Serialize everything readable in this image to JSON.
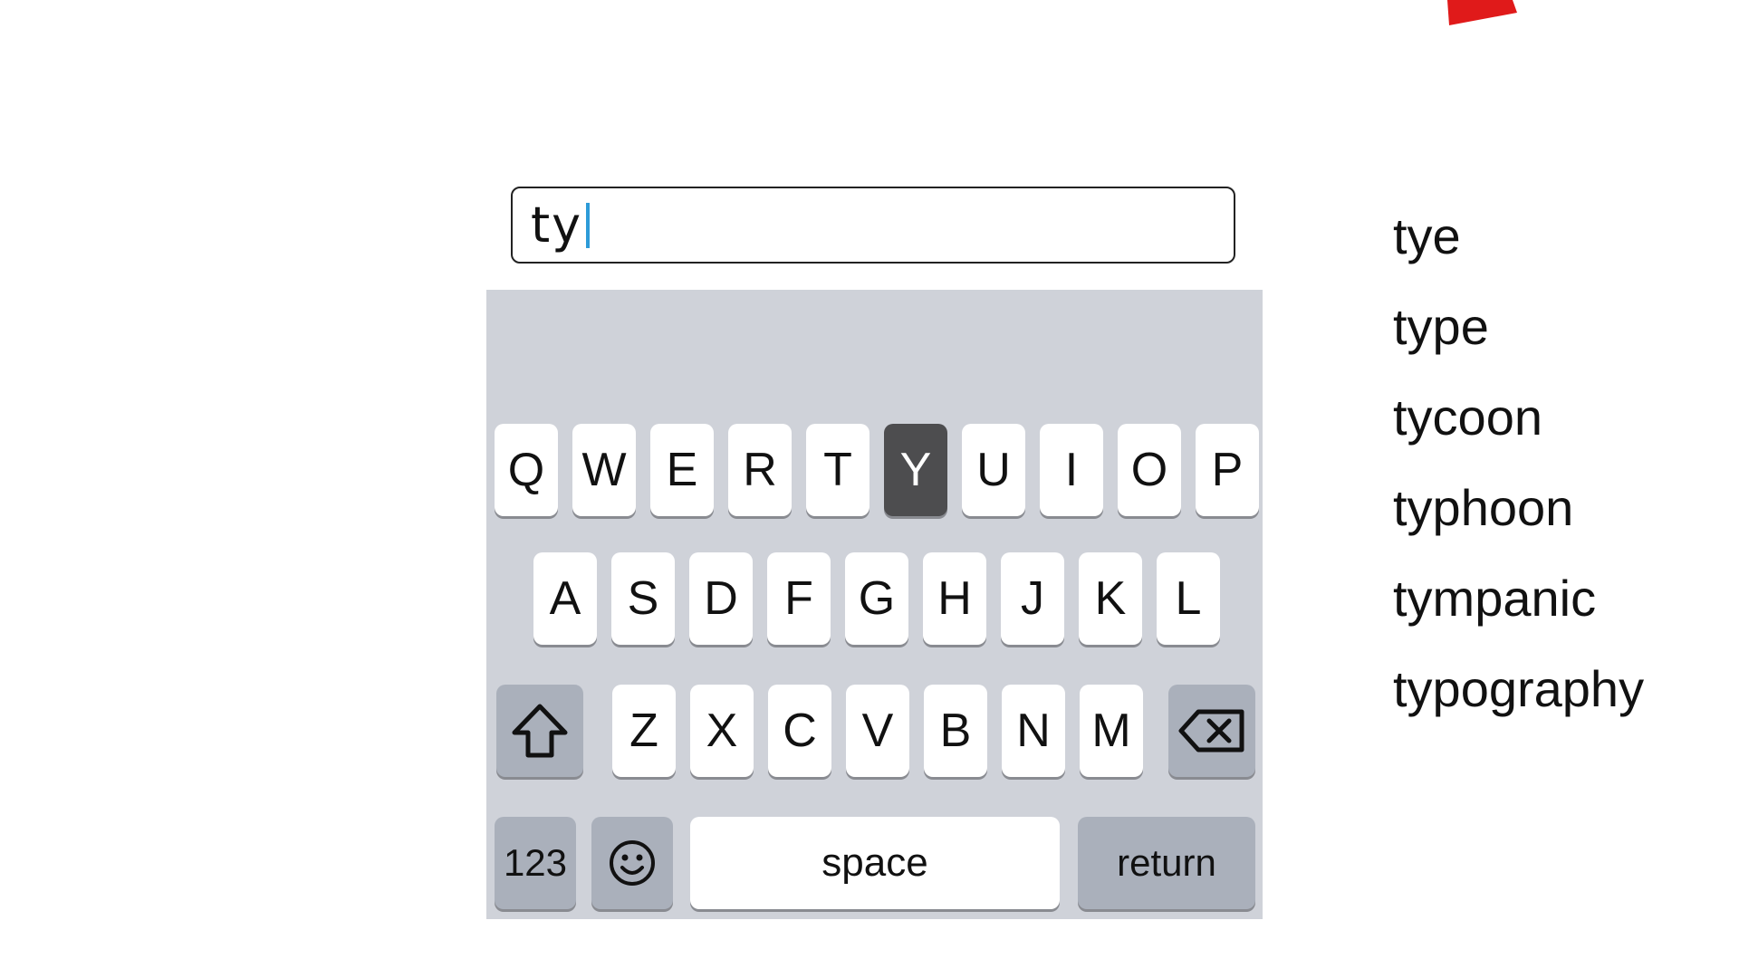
{
  "input": {
    "value": "ty"
  },
  "keyboard": {
    "row1": [
      "Q",
      "W",
      "E",
      "R",
      "T",
      "Y",
      "U",
      "I",
      "O",
      "P"
    ],
    "row2": [
      "A",
      "S",
      "D",
      "F",
      "G",
      "H",
      "J",
      "K",
      "L"
    ],
    "row3": [
      "Z",
      "X",
      "C",
      "V",
      "B",
      "N",
      "M"
    ],
    "pressed_key": "Y",
    "numbers_label": "123",
    "space_label": "space",
    "return_label": "return",
    "shift_icon": "shift-arrow-icon",
    "delete_icon": "backspace-icon",
    "emoji_icon": "smiley-icon"
  },
  "suggestions": [
    "tye",
    "type",
    "tycoon",
    "typhoon",
    "tympanic",
    "typography"
  ],
  "colors": {
    "keyboard_bg": "#cfd2d9",
    "key_bg": "#ffffff",
    "pressed_key_bg": "#4d4d4f",
    "function_key_bg": "#aab0bb",
    "caret": "#2d9bd8",
    "red_shape": "#e01a1a"
  }
}
